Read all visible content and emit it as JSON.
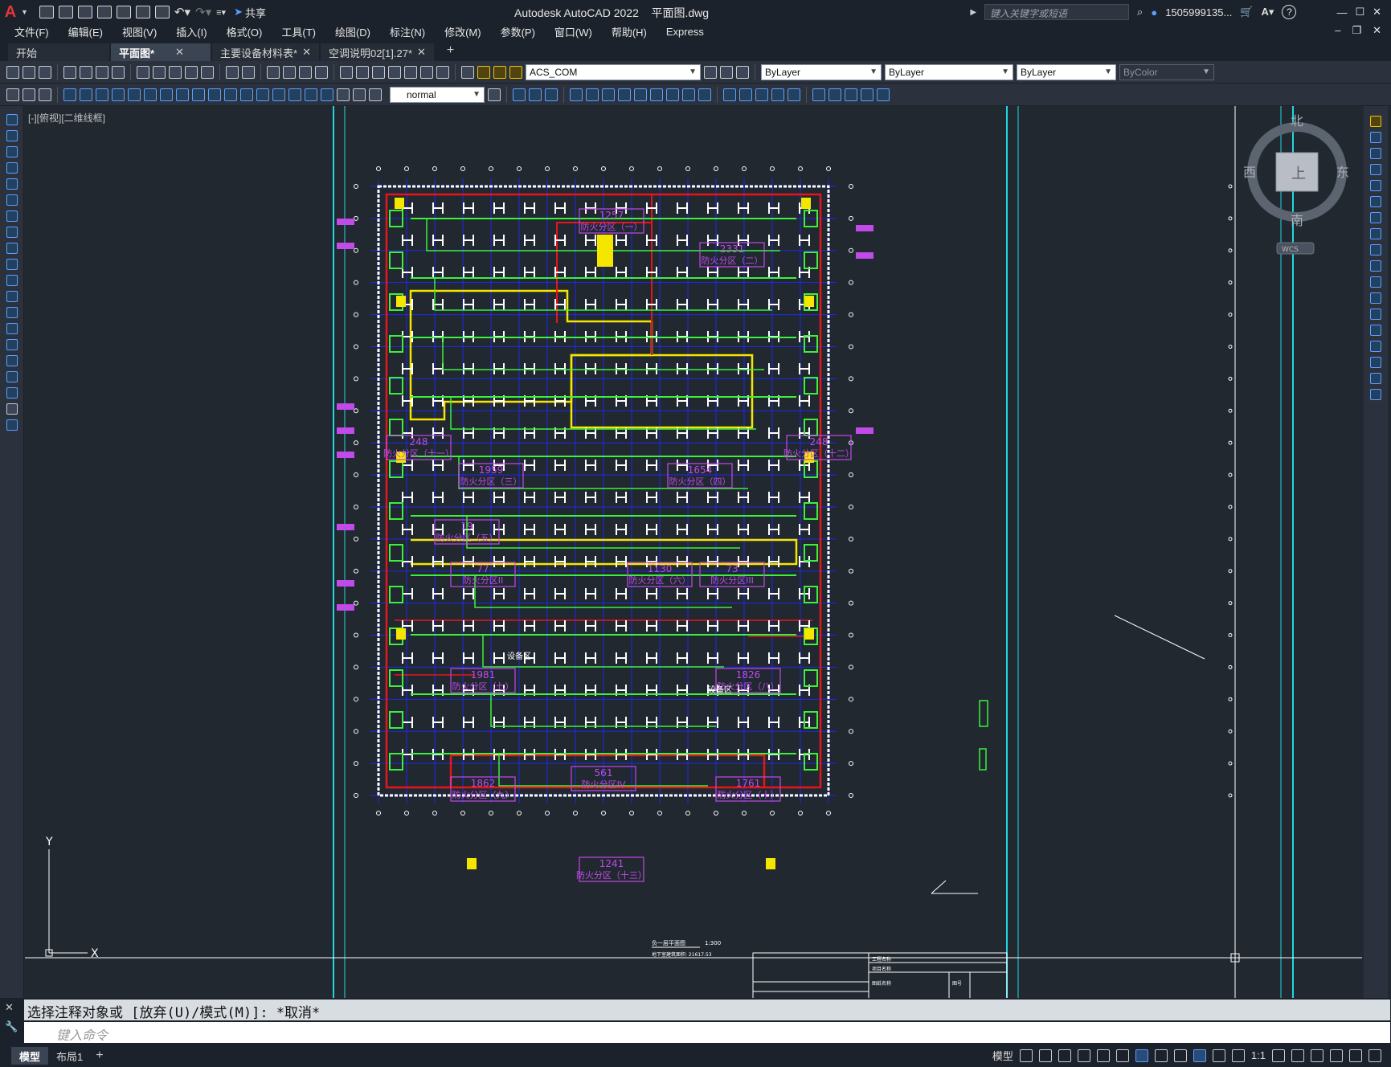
{
  "titlebar": {
    "app": "Autodesk AutoCAD 2022",
    "file": "平面图.dwg",
    "share_label": "共享",
    "search_placeholder": "键入关键字或短语",
    "user": "1505999135...",
    "help": "?"
  },
  "menu": [
    "文件(F)",
    "编辑(E)",
    "视图(V)",
    "插入(I)",
    "格式(O)",
    "工具(T)",
    "绘图(D)",
    "标注(N)",
    "修改(M)",
    "参数(P)",
    "窗口(W)",
    "帮助(H)",
    "Express"
  ],
  "tabs": [
    {
      "label": "开始",
      "closable": false,
      "active": false
    },
    {
      "label": "平面图*",
      "closable": true,
      "active": true
    },
    {
      "label": "主要设备材料表*",
      "closable": true,
      "active": false
    },
    {
      "label": "空调说明02[1].27*",
      "closable": true,
      "active": false
    }
  ],
  "toolbar1": {
    "layer": "ACS_COM",
    "color": "ByLayer",
    "linetype": "ByLayer",
    "lineweight": "ByLayer",
    "plotstyle": "ByColor"
  },
  "toolbar2": {
    "textstyle": "normal"
  },
  "viewport": {
    "label": "[-][俯视][二维线框]",
    "viewcube": {
      "north": "北",
      "south": "南",
      "east": "东",
      "west": "西",
      "face": "上",
      "wcs": "WCS"
    },
    "ucs": {
      "x": "X",
      "y": "Y"
    },
    "drawing_title": "负一层平面图",
    "drawing_scale": "1:300",
    "drawing_subtitle": "地下室建筑面积: 21617.53",
    "zones": [
      {
        "area": "1257",
        "name": "防火分区（一）"
      },
      {
        "area": "2331",
        "name": "防火分区（二）"
      },
      {
        "area": "248",
        "name": "防火分区（十一）"
      },
      {
        "area": "248",
        "name": "防火分区（十二）"
      },
      {
        "area": "1959",
        "name": "防火分区（三）"
      },
      {
        "area": "1654",
        "name": "防火分区（四）"
      },
      {
        "area": "19",
        "name": "防火分区（五）"
      },
      {
        "area": "77",
        "name": "防火分区II"
      },
      {
        "area": "1130",
        "name": "防火分区（六）"
      },
      {
        "area": "73",
        "name": "防火分区III"
      },
      {
        "area": "1981",
        "name": "防火分区（七）"
      },
      {
        "area": "1826",
        "name": "防火分区（八）"
      },
      {
        "area": "561",
        "name": "防火分区IV"
      },
      {
        "area": "1862",
        "name": "防火分区（九）"
      },
      {
        "area": "1761",
        "name": "防火分区（十）"
      },
      {
        "area": "1241",
        "name": "防火分区（十三）"
      }
    ],
    "labels": {
      "equip1": "设备区",
      "equip2": "设备区"
    },
    "titleblock": {
      "r1": "工程名称",
      "r2": "项目名称",
      "r3": "图纸名称",
      "r4": "图号"
    }
  },
  "command": {
    "history": "选择注释对象或 [放弃(U)/模式(M)]: *取消*",
    "placeholder": "键入命令"
  },
  "status": {
    "tabs": [
      {
        "label": "模型",
        "active": true
      },
      {
        "label": "布局1",
        "active": false
      }
    ],
    "model": "模型",
    "scale": "1:1"
  },
  "colors": {
    "background": "#212830",
    "wall": "#ffffff",
    "fire_red": "#e8141c",
    "fire_yellow": "#f5e600",
    "duct_green": "#3cf03c",
    "grid_blue": "#1e2ae6",
    "zone_magenta": "#c24ae8",
    "frame_cyan": "#22d8e0"
  }
}
